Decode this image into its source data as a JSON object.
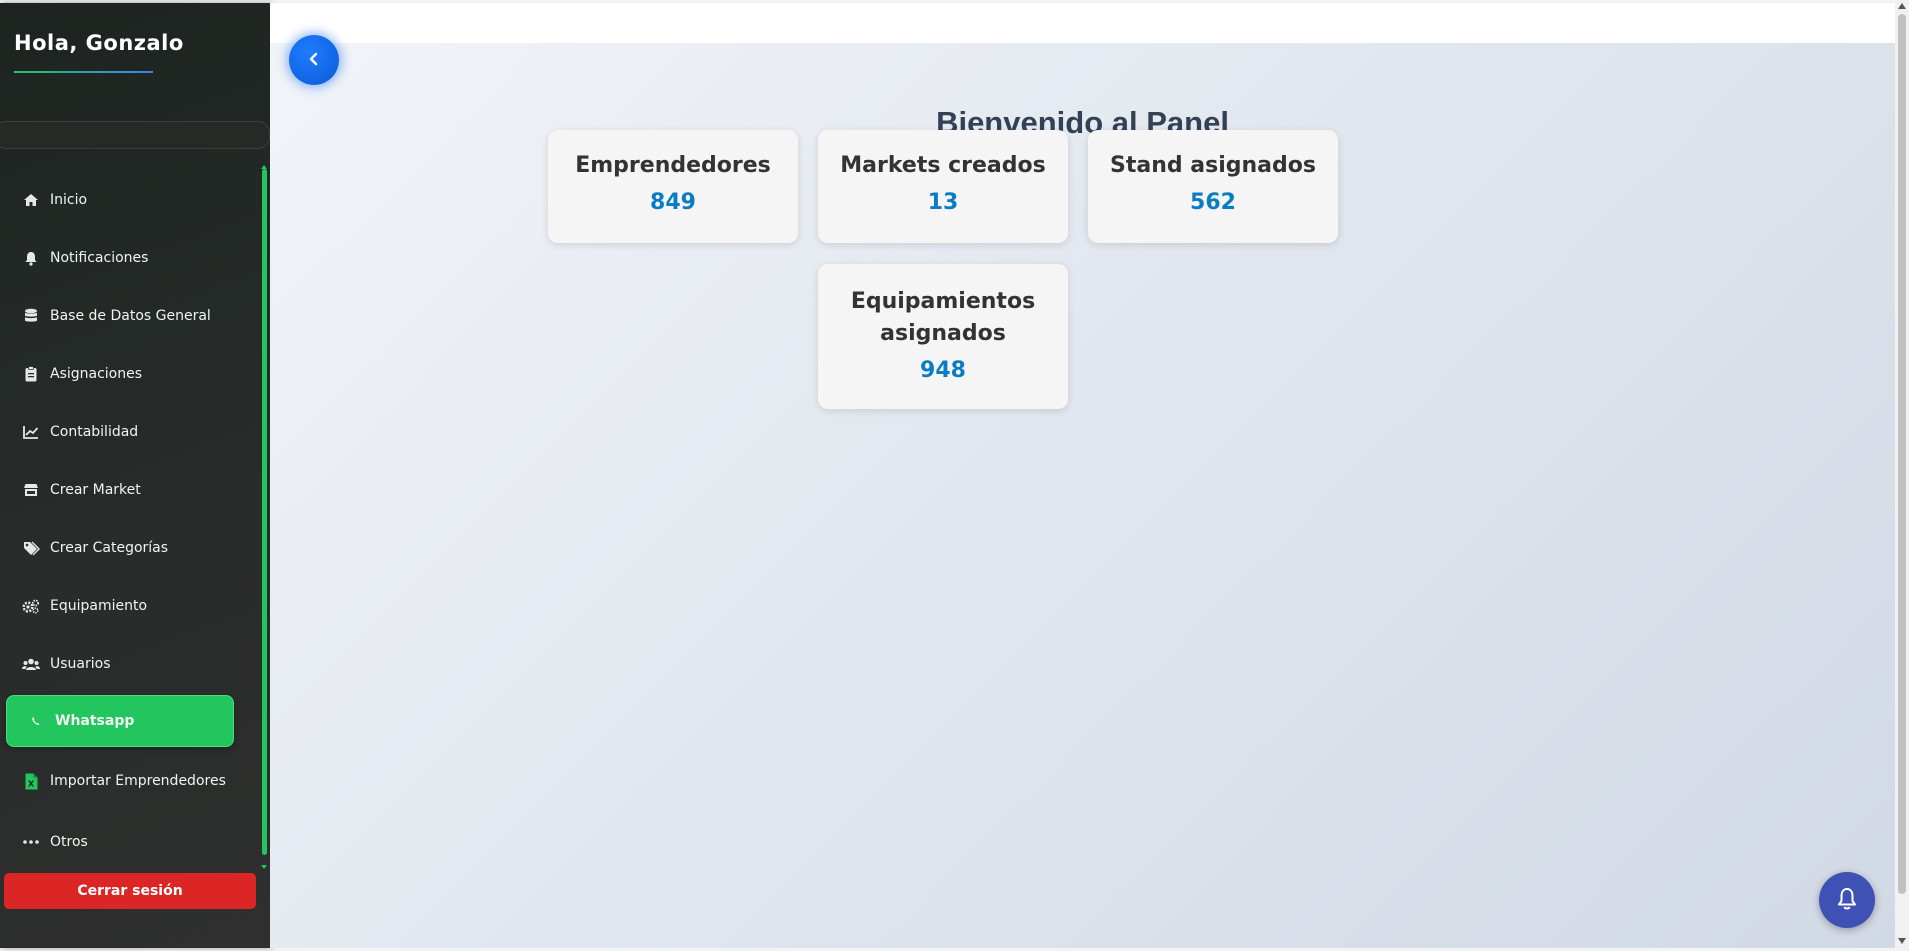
{
  "sidebar": {
    "greeting": "Hola, Gonzalo",
    "items": [
      {
        "label": "Inicio",
        "icon": "home-icon"
      },
      {
        "label": "Notificaciones",
        "icon": "bell-icon"
      },
      {
        "label": "Base de Datos General",
        "icon": "database-icon"
      },
      {
        "label": "Asignaciones",
        "icon": "clipboard-icon"
      },
      {
        "label": "Contabilidad",
        "icon": "chart-line-icon"
      },
      {
        "label": "Crear Market",
        "icon": "store-icon"
      },
      {
        "label": "Crear Categorías",
        "icon": "tags-icon"
      },
      {
        "label": "Equipamiento",
        "icon": "cogs-icon"
      },
      {
        "label": "Usuarios",
        "icon": "users-icon"
      },
      {
        "label": "Whatsapp",
        "icon": "phone-icon",
        "active": true
      },
      {
        "label": "Importar Emprendedores",
        "icon": "file-excel-icon"
      },
      {
        "label": "Otros",
        "icon": "ellipsis-icon"
      }
    ],
    "logout_label": "Cerrar sesión"
  },
  "main": {
    "title": "Bienvenido al Panel",
    "cards": [
      {
        "label": "Emprendedores",
        "value": "849"
      },
      {
        "label": "Markets creados",
        "value": "13"
      },
      {
        "label": "Stand asignados",
        "value": "562"
      },
      {
        "label": "Equipamientos asignados",
        "value": "948"
      }
    ]
  },
  "colors": {
    "accent_green": "#22c55e",
    "logout_red": "#dc2626",
    "value_blue": "#0a7cc4",
    "back_button_blue": "#1f7dff",
    "fab_indigo": "#3f51b5"
  }
}
